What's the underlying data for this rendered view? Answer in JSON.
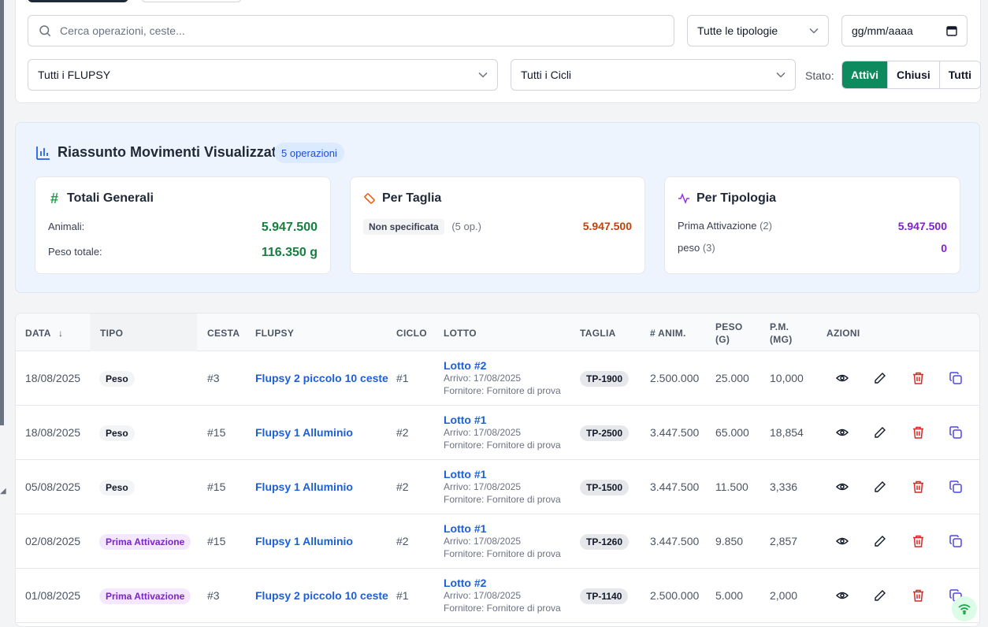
{
  "filters": {
    "search_placeholder": "Cerca operazioni, ceste...",
    "tipologia": "Tutte le tipologie",
    "date_placeholder": "gg/mm/aaaa",
    "flupsy": "Tutti i FLUPSY",
    "cicli": "Tutti i Cicli",
    "stato_label": "Stato:",
    "stato_options": [
      "Attivi",
      "Chiusi",
      "Tutti"
    ]
  },
  "summary": {
    "title": "Riassunto Movimenti Visualizzati",
    "count_badge": "5 operazioni",
    "totali": {
      "heading": "Totali Generali",
      "animali_label": "Animali:",
      "animali_value": "5.947.500",
      "peso_label": "Peso totale:",
      "peso_value": "116.350 g"
    },
    "per_taglia": {
      "heading": "Per Taglia",
      "chip": "Non specificata",
      "ops": "(5 op.)",
      "value": "5.947.500"
    },
    "per_tipologia": {
      "heading": "Per Tipologia",
      "row1_label": "Prima Attivazione",
      "row1_count": "(2)",
      "row1_value": "5.947.500",
      "row2_label": "peso",
      "row2_count": "(3)",
      "row2_value": "0"
    }
  },
  "table": {
    "headers": {
      "data": "DATA",
      "tipo": "TIPO",
      "cesta": "CESTA",
      "flupsy": "FLUPSY",
      "ciclo": "CICLO",
      "lotto": "LOTTO",
      "taglia": "TAGLIA",
      "anim": "# ANIM.",
      "peso_1": "PESO",
      "peso_2": "(G)",
      "pm_1": "P.M.",
      "pm_2": "(MG)",
      "azioni": "AZIONI"
    },
    "rows": [
      {
        "data": "18/08/2025",
        "tipo": "Peso",
        "cesta": "#3",
        "flupsy": "Flupsy 2 piccolo 10 ceste",
        "ciclo": "#1",
        "lotto": "Lotto #2",
        "arrivo": "Arrivo: 17/08/2025",
        "fornitore": "Fornitore: Fornitore di prova",
        "taglia": "TP-1900",
        "anim": "2.500.000",
        "peso": "25.000",
        "pm": "10,000"
      },
      {
        "data": "18/08/2025",
        "tipo": "Peso",
        "cesta": "#15",
        "flupsy": "Flupsy 1 Alluminio",
        "ciclo": "#2",
        "lotto": "Lotto #1",
        "arrivo": "Arrivo: 17/08/2025",
        "fornitore": "Fornitore: Fornitore di prova",
        "taglia": "TP-2500",
        "anim": "3.447.500",
        "peso": "65.000",
        "pm": "18,854"
      },
      {
        "data": "05/08/2025",
        "tipo": "Peso",
        "cesta": "#15",
        "flupsy": "Flupsy 1 Alluminio",
        "ciclo": "#2",
        "lotto": "Lotto #1",
        "arrivo": "Arrivo: 17/08/2025",
        "fornitore": "Fornitore: Fornitore di prova",
        "taglia": "TP-1500",
        "anim": "3.447.500",
        "peso": "11.500",
        "pm": "3,336"
      },
      {
        "data": "02/08/2025",
        "tipo": "Prima Attivazione",
        "cesta": "#15",
        "flupsy": "Flupsy 1 Alluminio",
        "ciclo": "#2",
        "lotto": "Lotto #1",
        "arrivo": "Arrivo: 17/08/2025",
        "fornitore": "Fornitore: Fornitore di prova",
        "taglia": "TP-1260",
        "anim": "3.447.500",
        "peso": "9.850",
        "pm": "2,857"
      },
      {
        "data": "01/08/2025",
        "tipo": "Prima Attivazione",
        "cesta": "#3",
        "flupsy": "Flupsy 2 piccolo 10 ceste",
        "ciclo": "#1",
        "lotto": "Lotto #2",
        "arrivo": "Arrivo: 17/08/2025",
        "fornitore": "Fornitore: Fornitore di prova",
        "taglia": "TP-1140",
        "anim": "2.500.000",
        "peso": "5.000",
        "pm": "2,000"
      }
    ]
  },
  "icons": {
    "search": "search-icon",
    "chevron": "chevron-down-icon",
    "calendar": "calendar-icon",
    "chart": "bar-chart-icon",
    "hash": "hash-icon",
    "ruler": "ruler-icon",
    "activity": "activity-icon",
    "view": "eye-icon",
    "edit": "pencil-icon",
    "delete": "trash-icon",
    "duplicate": "copy-icon",
    "wifi": "wifi-icon"
  },
  "colors": {
    "accent_green": "#0e8a5f",
    "link_blue": "#1d5fd6",
    "delete_red": "#dc2626",
    "duplicate_blue": "#4f46e5"
  }
}
